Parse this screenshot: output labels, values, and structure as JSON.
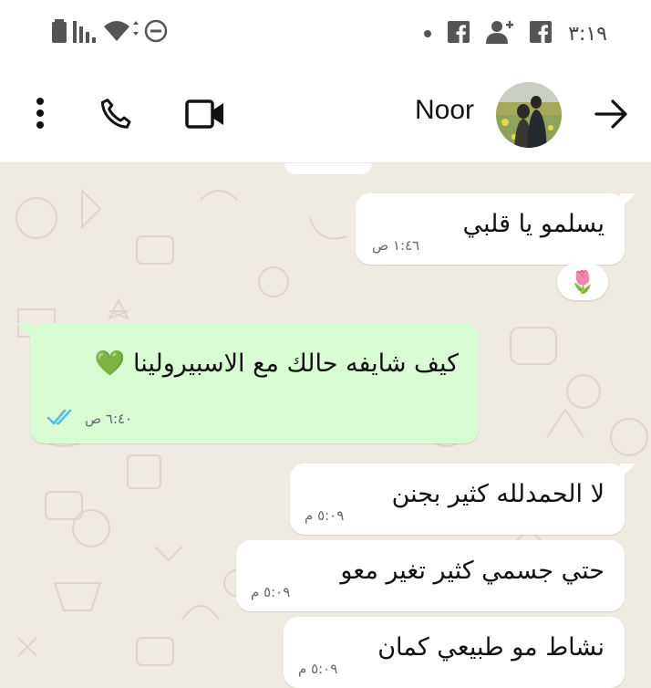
{
  "status_bar": {
    "time": "٣:١٩",
    "icons": [
      "battery-icon",
      "signal-icon",
      "wifi-icon",
      "do-not-disturb-icon",
      "dot-icon",
      "facebook-icon",
      "add-contact-icon",
      "facebook-icon"
    ]
  },
  "header": {
    "contact_name": "Noor",
    "icons": [
      "more-vert-icon",
      "phone-icon",
      "video-call-icon",
      "back-arrow-icon"
    ]
  },
  "messages": [
    {
      "dir": "in",
      "text": "يسلمو يا قلبي",
      "time": "١:٤٦ ص",
      "reaction": "🌷"
    },
    {
      "dir": "out",
      "text": "كيف شايفه حالك مع الاسبيرولينا 💚",
      "time": "٦:٤٠ ص",
      "status": "read"
    },
    {
      "dir": "in",
      "text": "لا الحمدلله كثير بجنن",
      "time": "٥:٠٩ م"
    },
    {
      "dir": "in",
      "text": "حتي جسمي كثير تغير معو",
      "time": "٥:٠٩ م"
    },
    {
      "dir": "in",
      "text": "نشاط مو طبيعي كمان",
      "time": "٥:٠٩ م"
    }
  ],
  "colors": {
    "chat_bg": "#efeae2",
    "incoming": "#ffffff",
    "outgoing": "#d9fdd3",
    "read_ticks": "#53bdeb"
  }
}
